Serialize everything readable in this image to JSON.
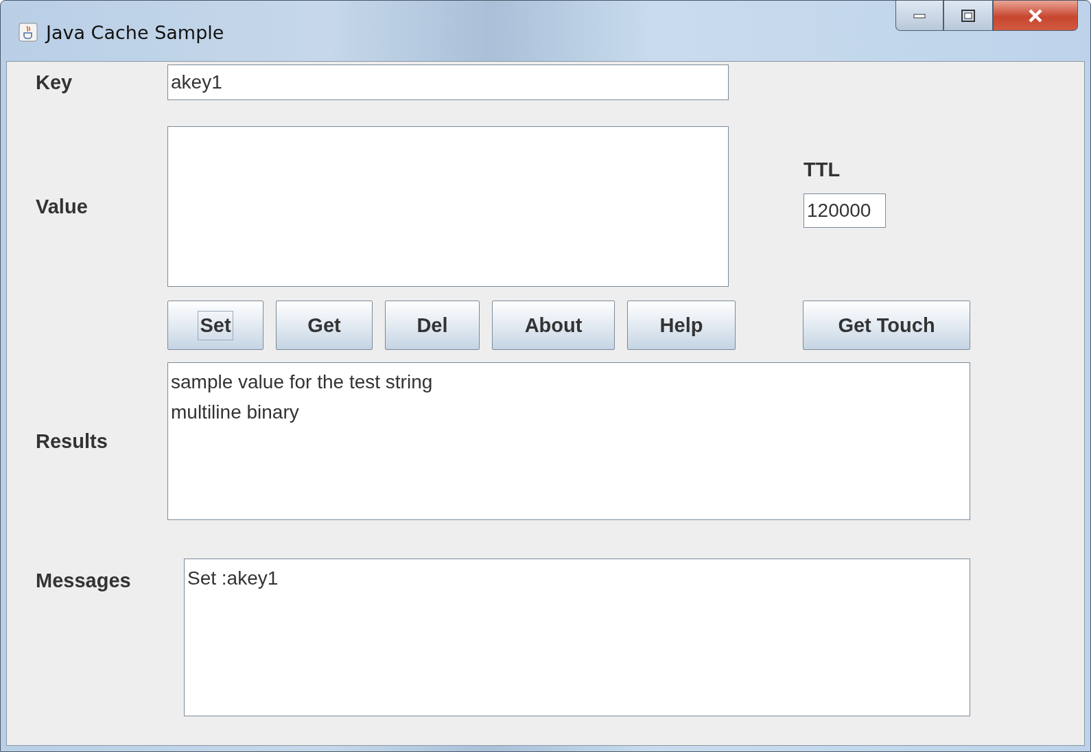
{
  "window": {
    "title": "Java Cache Sample"
  },
  "key": {
    "label": "Key",
    "value": "akey1"
  },
  "value": {
    "label": "Value"
  },
  "ttl": {
    "label": "TTL",
    "value": "120000"
  },
  "buttons": [
    {
      "label": "Set",
      "focused": true
    },
    {
      "label": "Get",
      "focused": false
    },
    {
      "label": "Del",
      "focused": false
    },
    {
      "label": "About",
      "focused": false
    },
    {
      "label": "Help",
      "focused": false
    }
  ],
  "touch_button": {
    "label": "Get Touch",
    "focused": false
  },
  "results": {
    "label": "Results",
    "lines": [
      "sample value for the test string",
      "multiline binary"
    ]
  },
  "messages": {
    "label": "Messages",
    "lines": [
      "Set :akey1"
    ]
  }
}
